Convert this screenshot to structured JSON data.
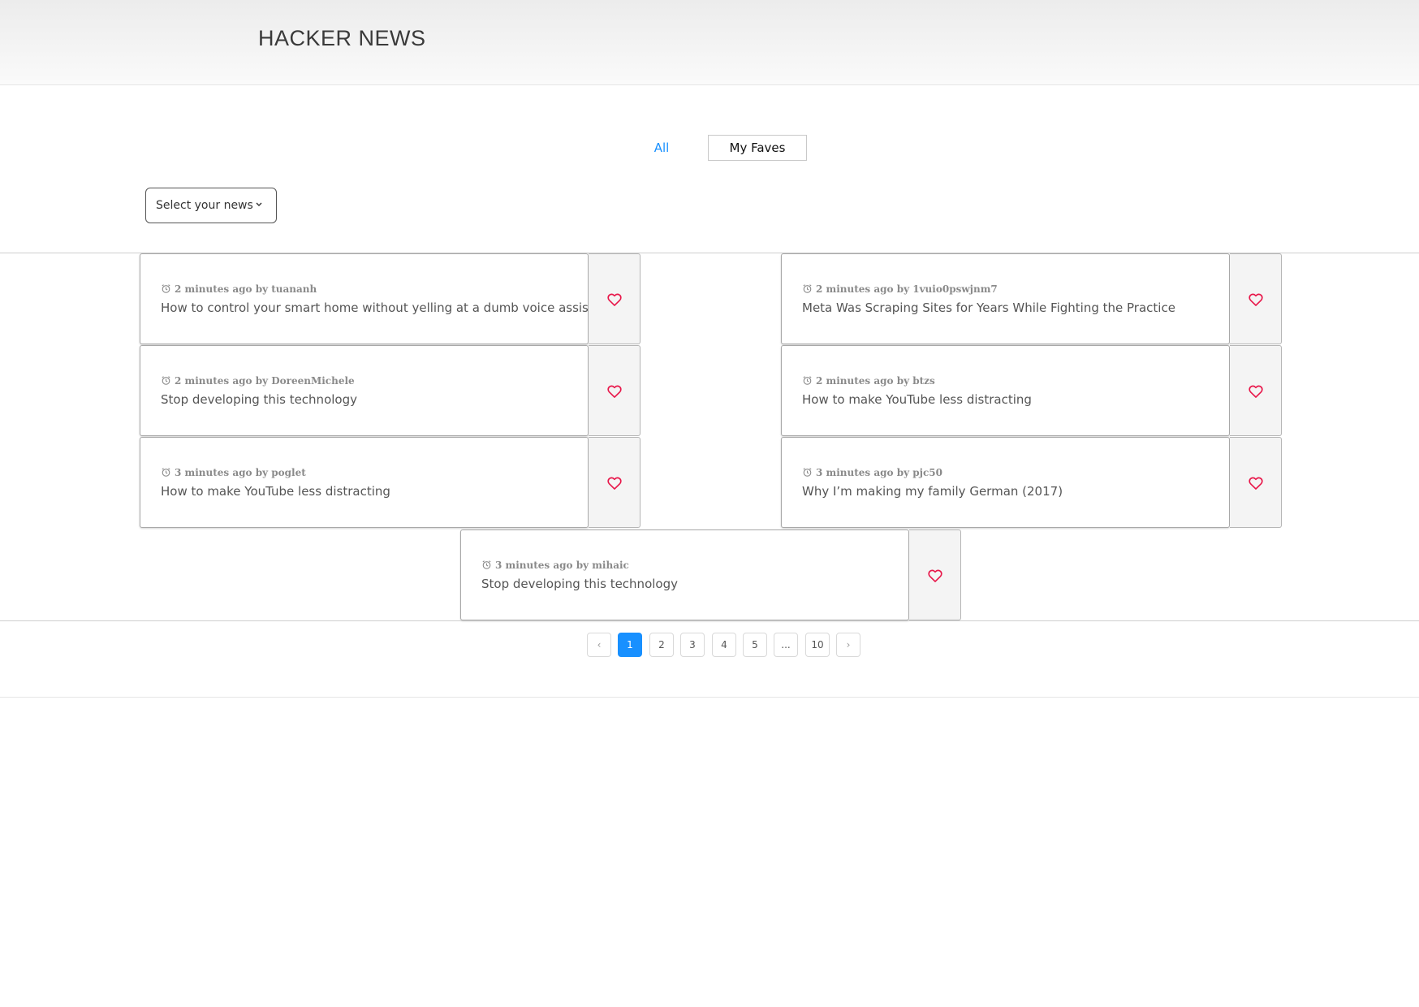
{
  "header": {
    "title": "HACKER NEWS"
  },
  "tabs": {
    "all": "All",
    "faves": "My Faves"
  },
  "filter": {
    "select_label": "Select your news"
  },
  "stories": [
    {
      "meta": "2 minutes ago by tuananh",
      "title": "How to control your smart home without yelling at a dumb voice assistant"
    },
    {
      "meta": "2 minutes ago by 1vuio0pswjnm7",
      "title": "Meta Was Scraping Sites for Years While Fighting the Practice"
    },
    {
      "meta": "2 minutes ago by DoreenMichele",
      "title": "Stop developing this technology"
    },
    {
      "meta": "2 minutes ago by btzs",
      "title": "How to make YouTube less distracting"
    },
    {
      "meta": "3 minutes ago by poglet",
      "title": "How to make YouTube less distracting"
    },
    {
      "meta": "3 minutes ago by pjc50",
      "title": "Why I’m making my family German (2017)"
    },
    {
      "meta": "3 minutes ago by mihaic",
      "title": "Stop developing this technology"
    }
  ],
  "pagination": {
    "prev": "‹",
    "pages": [
      "1",
      "2",
      "3",
      "4",
      "5",
      "...",
      "10"
    ],
    "next": "›",
    "current": "1"
  },
  "colors": {
    "accent": "#1890ff",
    "heart": "#e8174a"
  },
  "icons": {
    "clock": "clock-icon",
    "heart": "heart-icon",
    "chevron": "chevron-down-icon"
  }
}
